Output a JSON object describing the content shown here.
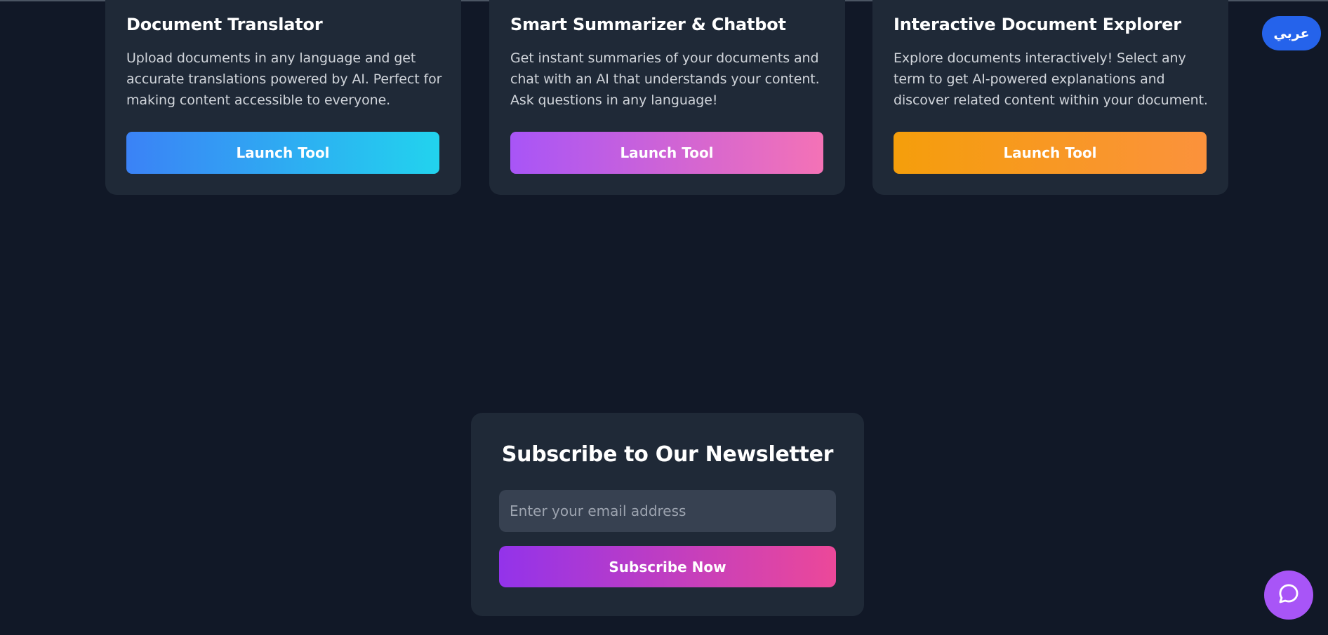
{
  "tools": [
    {
      "title": "Document Translator",
      "description": "Upload documents in any language and get accurate translations powered by AI. Perfect for making content accessible to everyone.",
      "button_label": "Launch Tool",
      "accent": [
        "#3b82f6",
        "#22d3ee"
      ]
    },
    {
      "title": "Smart Summarizer & Chatbot",
      "description": "Get instant summaries of your documents and chat with an AI that understands your content. Ask questions in any language!",
      "button_label": "Launch Tool",
      "accent": [
        "#a855f7",
        "#f472b6"
      ]
    },
    {
      "title": "Interactive Document Explorer",
      "description": "Explore documents interactively! Select any term to get AI-powered explanations and discover related content within your document.",
      "button_label": "Launch Tool",
      "accent": [
        "#f59e0b",
        "#fb923c"
      ]
    }
  ],
  "language_toggle": {
    "label": "عربي",
    "color": "#2563eb"
  },
  "newsletter": {
    "title": "Subscribe to Our Newsletter",
    "email_placeholder": "Enter your email address",
    "email_value": "",
    "subscribe_label": "Subscribe Now",
    "accent": [
      "#9333ea",
      "#ec4899"
    ]
  },
  "chat_widget": {
    "icon": "chat-bubble-icon",
    "color": "#a855f7"
  },
  "theme": {
    "background": "#111827",
    "card": "#1f2937",
    "input": "#374151"
  }
}
